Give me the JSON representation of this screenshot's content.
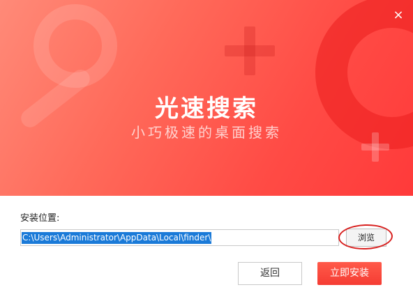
{
  "window": {
    "close_label": "×"
  },
  "banner": {
    "title": "光速搜索",
    "subtitle": "小巧极速的桌面搜索"
  },
  "install": {
    "location_label": "安装位置:",
    "path_value": "C:\\Users\\Administrator\\AppData\\Local\\finder\\",
    "browse_label": "浏览"
  },
  "actions": {
    "back_label": "返回",
    "install_label": "立即安装"
  },
  "colors": {
    "accent": "#ff4b45",
    "selection": "#1a7ad8",
    "highlight_ring": "#d8201f"
  }
}
